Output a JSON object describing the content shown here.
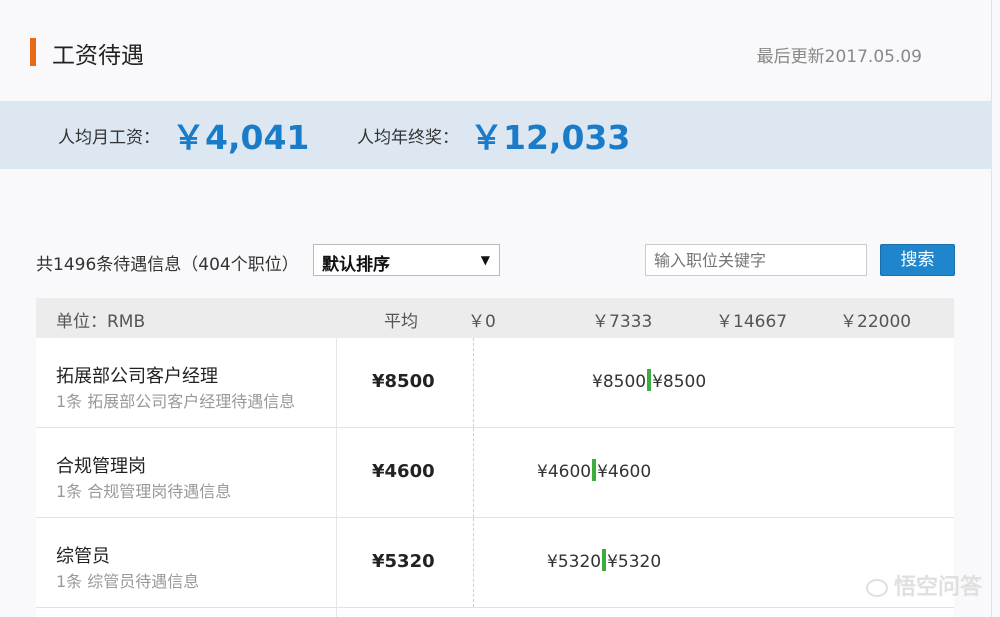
{
  "header": {
    "title": "工资待遇",
    "updated": "最后更新2017.05.09"
  },
  "summary": {
    "monthly_label": "人均月工资：",
    "monthly_value": "￥4,041",
    "bonus_label": "人均年终奖：",
    "bonus_value": "￥12,033"
  },
  "filters": {
    "count_text": "共1496条待遇信息（404个职位）",
    "sort_value": "默认排序",
    "search_placeholder": "输入职位关键字",
    "search_button": "搜索"
  },
  "table": {
    "headers": {
      "unit": "单位：RMB",
      "avg": "平均",
      "tick0": "￥0",
      "tick1": "￥7333",
      "tick2": "￥14667",
      "tick3": "￥22000"
    },
    "rows": [
      {
        "name": "拓展部公司客户经理",
        "sub": "1条 拓展部公司客户经理待遇信息",
        "avg": "¥8500",
        "min": "¥8500",
        "max": "¥8500",
        "value": 8500
      },
      {
        "name": "合规管理岗",
        "sub": "1条 合规管理岗待遇信息",
        "avg": "¥4600",
        "min": "¥4600",
        "max": "¥4600",
        "value": 4600
      },
      {
        "name": "综管员",
        "sub": "1条 综管员待遇信息",
        "avg": "¥5320",
        "min": "¥5320",
        "max": "¥5320",
        "value": 5320
      }
    ]
  },
  "watermark": "悟空问答"
}
